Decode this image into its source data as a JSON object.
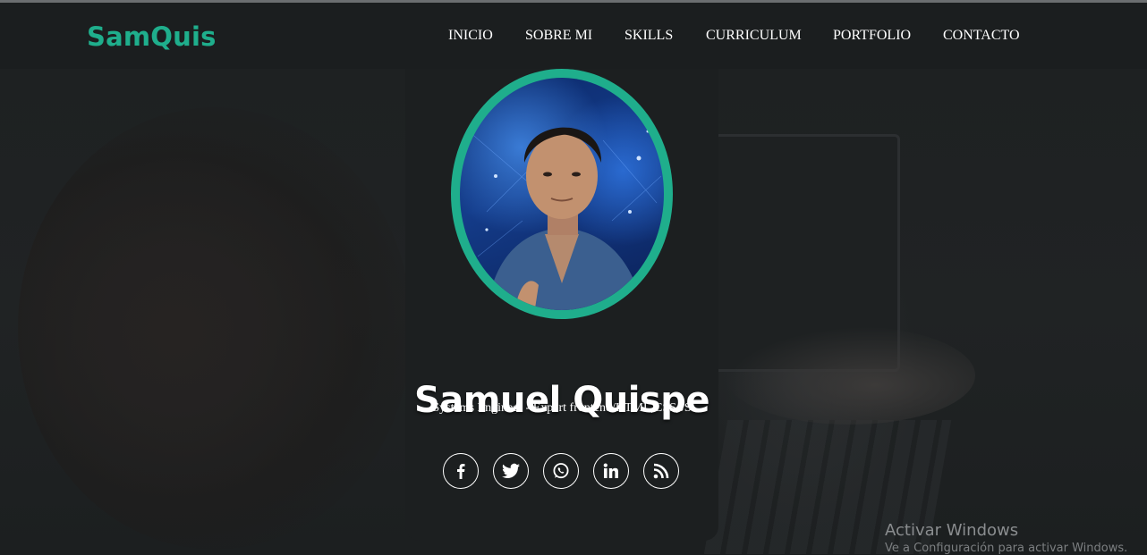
{
  "navbar": {
    "brand": "SamQuis",
    "links": [
      {
        "label": "INICIO"
      },
      {
        "label": "SOBRE MI"
      },
      {
        "label": "SKILLS"
      },
      {
        "label": "CURRICULUM"
      },
      {
        "label": "PORTFOLIO"
      },
      {
        "label": "CONTACTO"
      }
    ]
  },
  "profile": {
    "name": "Samuel Quispe",
    "tagline": "Systems Engineer - Expert frontend/HTML,CSS,JS",
    "avatar_icon": "profile-photo",
    "social": [
      {
        "icon": "facebook-icon"
      },
      {
        "icon": "twitter-icon"
      },
      {
        "icon": "whatsapp-icon"
      },
      {
        "icon": "linkedin-icon"
      },
      {
        "icon": "rss-icon"
      }
    ]
  },
  "watermark": {
    "title": "Activar Windows",
    "subtitle": "Ve a Configuración para activar Windows."
  },
  "colors": {
    "accent": "#1fae8c",
    "background": "#1b1e1f",
    "text": "#ffffff"
  }
}
